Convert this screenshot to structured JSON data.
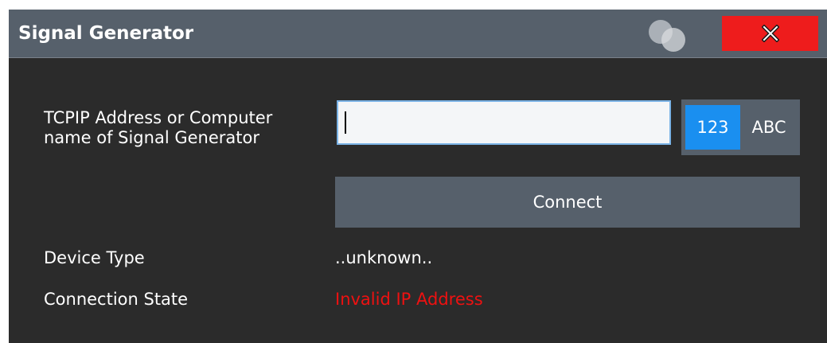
{
  "dialog": {
    "title": "Signal Generator",
    "close_icon": "x-icon",
    "logo_icon": "overlapping-circles-icon"
  },
  "form": {
    "address_label": "TCPIP Address or Computer\nname of Signal Generator",
    "address_value": "",
    "keyboard_numeric": "123",
    "keyboard_alpha": "ABC",
    "connect_label": "Connect",
    "device_type_label": "Device Type",
    "device_type_value": "..unknown..",
    "connection_state_label": "Connection State",
    "connection_state_value": "Invalid IP Address"
  },
  "colors": {
    "titlebar": "#56606b",
    "body": "#2b2b2b",
    "close": "#ee1c1c",
    "active_key": "#1a8ff0",
    "error": "#ee1111"
  }
}
